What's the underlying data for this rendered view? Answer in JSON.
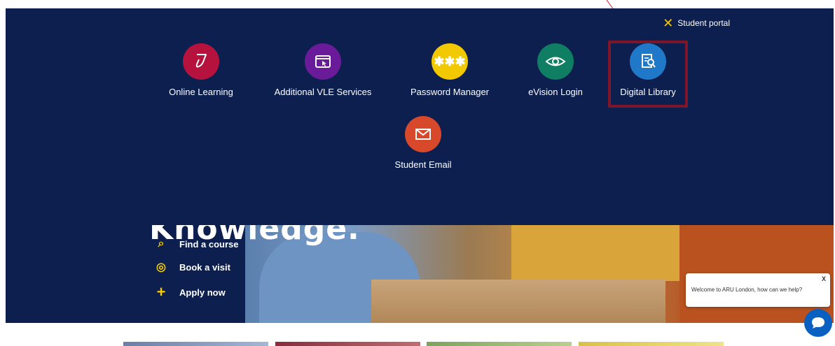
{
  "portal": {
    "close_label": "Student portal",
    "tiles": [
      {
        "label": "Online Learning",
        "color": "#b5123e",
        "icon": "pen-hand-icon"
      },
      {
        "label": "Additional VLE Services",
        "color": "#6a1b9a",
        "icon": "browser-window-icon"
      },
      {
        "label": "Password Manager",
        "color": "#f2c800",
        "icon": "asterisks-icon"
      },
      {
        "label": "eVision Login",
        "color": "#0f7e63",
        "icon": "eye-icon"
      },
      {
        "label": "Digital Library",
        "color": "#1f78c8",
        "icon": "document-search-icon"
      },
      {
        "label": "Student Email",
        "color": "#d8482a",
        "icon": "envelope-icon"
      }
    ],
    "highlighted_tile": "Digital Library"
  },
  "hero": {
    "heading": "Knowledge.",
    "links": [
      {
        "label": "Find a course",
        "icon": "search-icon"
      },
      {
        "label": "Book a visit",
        "icon": "location-pin-icon"
      },
      {
        "label": "Apply now",
        "icon": "plus-icon"
      }
    ]
  },
  "chat": {
    "message": "Welcome to ARU London, how can we help?",
    "close": "X"
  },
  "colors": {
    "navy": "#0c1f4e",
    "accent_yellow": "#f3c900",
    "highlight_border": "#7d1628"
  }
}
